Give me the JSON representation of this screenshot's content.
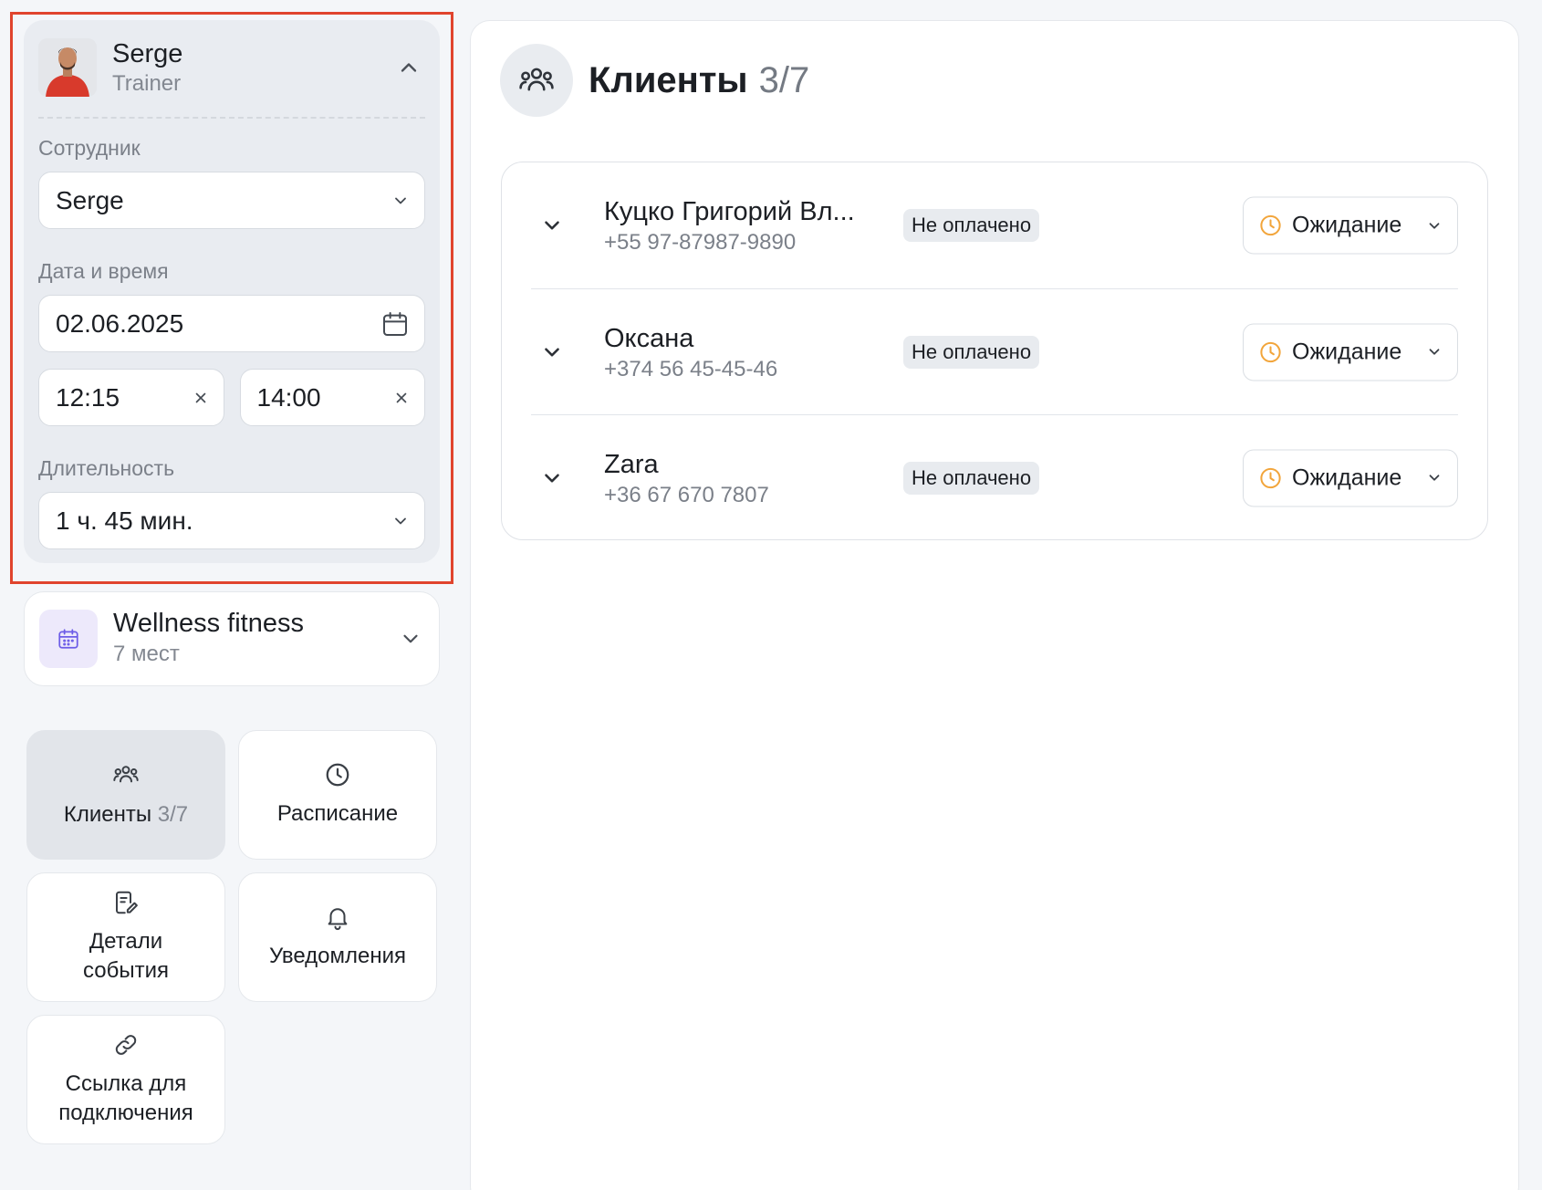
{
  "trainer": {
    "name": "Serge",
    "role": "Trainer",
    "employee_label": "Сотрудник",
    "employee_value": "Serge",
    "datetime_label": "Дата и время",
    "date_value": "02.06.2025",
    "time_start": "12:15",
    "time_end": "14:00",
    "duration_label": "Длительность",
    "duration_value": "1 ч. 45 мин."
  },
  "club": {
    "name": "Wellness fitness",
    "seats": "7 мест"
  },
  "tiles": {
    "clients_label": "Клиенты",
    "clients_count": "3/7",
    "schedule_label": "Расписание",
    "details_line1": "Детали",
    "details_line2": "события",
    "notifications_label": "Уведомления",
    "link_line1": "Ссылка для",
    "link_line2": "подключения"
  },
  "main": {
    "title": "Клиенты",
    "count": "3/7"
  },
  "clients": [
    {
      "name": "Куцко Григорий Вл...",
      "phone": "+55 97-87987-9890",
      "payment": "Не оплачено",
      "status": "Ожидание"
    },
    {
      "name": "Оксана",
      "phone": "+374 56 45-45-46",
      "payment": "Не оплачено",
      "status": "Ожидание"
    },
    {
      "name": "Zara",
      "phone": "+36 67 670 7807",
      "payment": "Не оплачено",
      "status": "Ожидание"
    }
  ],
  "colors": {
    "highlight": "#e0442d",
    "status_icon": "#f2a53b",
    "club_icon": "#6c5ce7"
  },
  "icons": {
    "collapse": "chevron-up-icon",
    "dropdown": "chevron-down-icon",
    "calendar": "calendar-icon",
    "clear": "close-icon",
    "users": "users-icon",
    "clock": "clock-icon",
    "edit": "edit-note-icon",
    "bell": "bell-icon",
    "link": "link-icon"
  }
}
